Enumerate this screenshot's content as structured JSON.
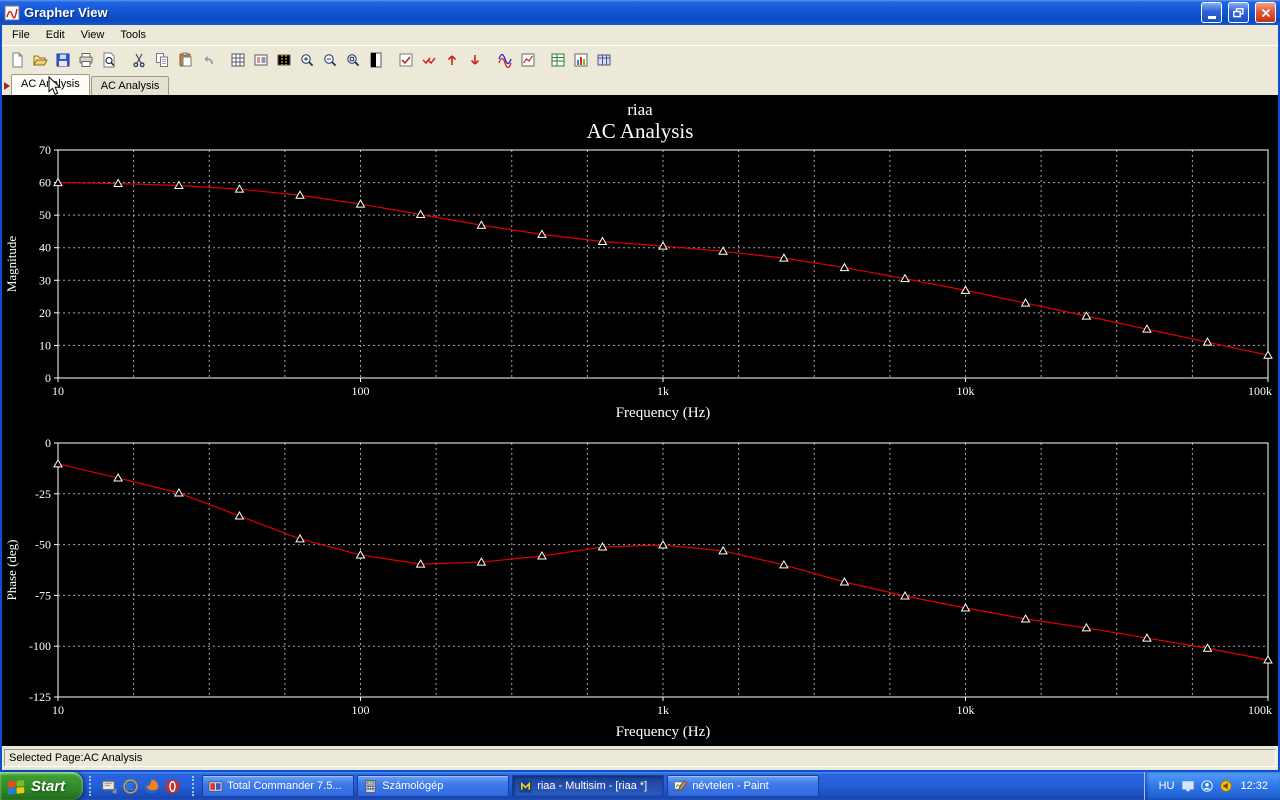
{
  "window": {
    "title": "Grapher View"
  },
  "menu": {
    "items": [
      "File",
      "Edit",
      "View",
      "Tools"
    ]
  },
  "toolbar": {
    "groups": [
      [
        "new",
        "open",
        "save",
        "print",
        "print-preview"
      ],
      [
        "cut",
        "copy",
        "paste",
        "undo"
      ],
      [
        "show-grid",
        "show-legend",
        "show-cursors",
        "zoom-in",
        "zoom-out",
        "zoom-restore",
        "black-white"
      ],
      [
        "show-select-marks",
        "select-all-marks",
        "previous-page",
        "next-page"
      ],
      [
        "overlay-traces",
        "export-graph"
      ],
      [
        "export-excel",
        "export-chart",
        "export-table"
      ]
    ]
  },
  "tabs": [
    {
      "label": "AC Analysis",
      "active": true
    },
    {
      "label": "AC Analysis",
      "active": false
    }
  ],
  "chart_data": [
    {
      "type": "line",
      "title": "riaa",
      "subtitle": "AC Analysis",
      "ylabel": "Magnitude",
      "xlabel": "Frequency (Hz)",
      "x_scale": "log",
      "grid": "dashed",
      "legend": false,
      "xlim": [
        10,
        100000
      ],
      "ylim": [
        0,
        70
      ],
      "yticks": [
        70,
        60,
        50,
        40,
        30,
        20,
        10,
        0
      ],
      "xticks": [
        {
          "value": 10,
          "label": "10"
        },
        {
          "value": 100,
          "label": "100"
        },
        {
          "value": 1000,
          "label": "1k"
        },
        {
          "value": 10000,
          "label": "10k"
        },
        {
          "value": 100000,
          "label": "100k"
        }
      ],
      "series": [
        {
          "name": "Magnitude",
          "color": "#e00000",
          "marker": "triangle",
          "x": [
            10,
            15.8,
            25.1,
            39.8,
            63.1,
            100,
            158,
            251,
            398,
            631,
            1000,
            1580,
            2510,
            3980,
            6310,
            10000,
            15800,
            25100,
            39800,
            63100,
            100000
          ],
          "y": [
            60.0,
            59.7,
            59.1,
            58.0,
            56.1,
            53.4,
            50.2,
            46.9,
            44.1,
            41.9,
            40.5,
            38.9,
            36.8,
            33.9,
            30.5,
            26.9,
            23.0,
            19.0,
            15.0,
            11.0,
            7.0
          ]
        }
      ]
    },
    {
      "type": "line",
      "title": "riaa",
      "subtitle": "AC Analysis",
      "ylabel": "Phase (deg)",
      "xlabel": "Frequency (Hz)",
      "x_scale": "log",
      "grid": "dashed",
      "legend": false,
      "xlim": [
        10,
        100000
      ],
      "ylim": [
        -125,
        0
      ],
      "yticks": [
        0,
        -25,
        -50,
        -75,
        -100,
        -125
      ],
      "xticks": [
        {
          "value": 10,
          "label": "10"
        },
        {
          "value": 100,
          "label": "100"
        },
        {
          "value": 1000,
          "label": "1k"
        },
        {
          "value": 10000,
          "label": "10k"
        },
        {
          "value": 100000,
          "label": "100k"
        }
      ],
      "series": [
        {
          "name": "Phase",
          "color": "#e00000",
          "marker": "triangle",
          "x": [
            10,
            15.8,
            25.1,
            39.8,
            63.1,
            100,
            158,
            251,
            398,
            631,
            1000,
            1580,
            2510,
            3980,
            6310,
            10000,
            15800,
            25100,
            39800,
            63100,
            100000
          ],
          "y": [
            -10.3,
            -17.2,
            -24.6,
            -35.9,
            -47.2,
            -55.1,
            -59.6,
            -58.6,
            -55.6,
            -51.2,
            -50.2,
            -53.1,
            -60.0,
            -68.4,
            -75.3,
            -81.2,
            -86.6,
            -91.0,
            -96.0,
            -101.0,
            -106.8
          ]
        }
      ]
    }
  ],
  "status_bar": {
    "text": "Selected Page:AC Analysis"
  },
  "taskbar": {
    "start_label": "Start",
    "quick_launch": [
      "show-desktop",
      "internet-explorer",
      "firefox",
      "opera"
    ],
    "buttons": [
      {
        "label": "Total Commander 7.5...",
        "icon": "total-commander",
        "active": false
      },
      {
        "label": "Számológép",
        "icon": "calculator",
        "active": false
      },
      {
        "label": "riaa - Multisim - [riaa *]",
        "icon": "multisim",
        "active": true
      },
      {
        "label": "névtelen - Paint",
        "icon": "paint",
        "active": false
      }
    ],
    "tray": {
      "language": "HU",
      "icons": [
        "display",
        "messenger",
        "volume"
      ],
      "clock": "12:32"
    }
  }
}
